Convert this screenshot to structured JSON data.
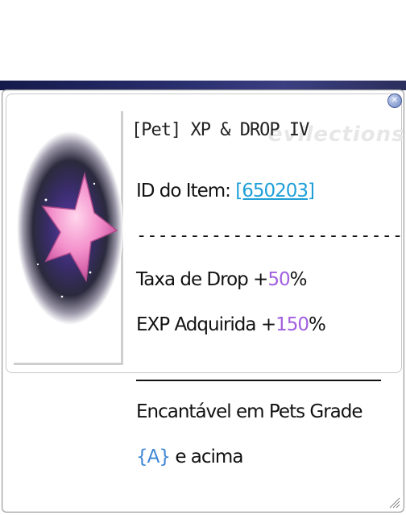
{
  "tooltip": {
    "title": "[Pet] XP & DROP IV",
    "watermark": "evilections",
    "id_label": "ID do Item:",
    "id_value": "[650203]",
    "separator": "-------------------------",
    "drop_prefix": "Taxa de Drop +",
    "drop_value": "50",
    "drop_suffix": "%",
    "exp_prefix": "EXP Adquirida +",
    "exp_value": "150",
    "exp_suffix": "%",
    "enchant_line1": "Encantável em Pets Grade",
    "grade_value": "{A}",
    "enchant_line2_suffix": " e acima"
  },
  "icons": {
    "close": "close-icon",
    "item": "pink-star-icon",
    "grip": "resize-grip-icon"
  },
  "colors": {
    "link": "#1e9fd8",
    "drop_value": "#a25fe0",
    "exp_value": "#a25fe0",
    "grade": "#3e86d6"
  }
}
